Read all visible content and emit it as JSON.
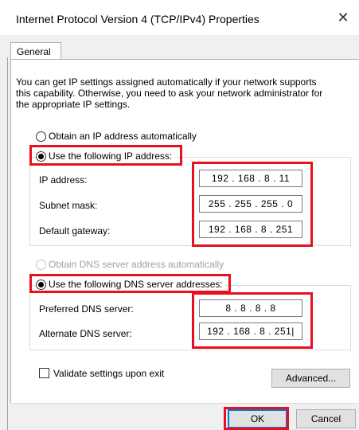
{
  "window": {
    "title": "Internet Protocol Version 4 (TCP/IPv4) Properties",
    "close_icon": "close-icon"
  },
  "tabs": [
    {
      "label": "General",
      "selected": true
    }
  ],
  "intro_text": "You can get IP settings assigned automatically if your network supports this capability. Otherwise, you need to ask your network administrator for the appropriate IP settings.",
  "ip_section": {
    "auto_option": {
      "label": "Obtain an IP address automatically",
      "selected": false
    },
    "manual_option": {
      "label": "Use the following IP address:",
      "selected": true
    },
    "fields": [
      {
        "label": "IP address:",
        "value": "192 . 168 .  8  . 11"
      },
      {
        "label": "Subnet mask:",
        "value": "255 . 255 . 255 .  0"
      },
      {
        "label": "Default gateway:",
        "value": "192 . 168 .  8  . 251"
      }
    ]
  },
  "dns_section": {
    "auto_option": {
      "label": "Obtain DNS server address automatically",
      "selected": false,
      "disabled": true
    },
    "manual_option": {
      "label": "Use the following DNS server addresses:",
      "selected": true
    },
    "fields": [
      {
        "label": "Preferred DNS server:",
        "value": "8  .  8  .  8  .  8"
      },
      {
        "label": "Alternate DNS server:",
        "value": "192 . 168 .  8  . 251|"
      }
    ]
  },
  "validate_checkbox": {
    "label": "Validate settings upon exit",
    "checked": false
  },
  "buttons": {
    "advanced": "Advanced...",
    "ok": "OK",
    "cancel": "Cancel"
  },
  "colors": {
    "highlight": "#e8101f",
    "dialog_bg": "#f0f0f0",
    "accent": "#0078d7"
  }
}
